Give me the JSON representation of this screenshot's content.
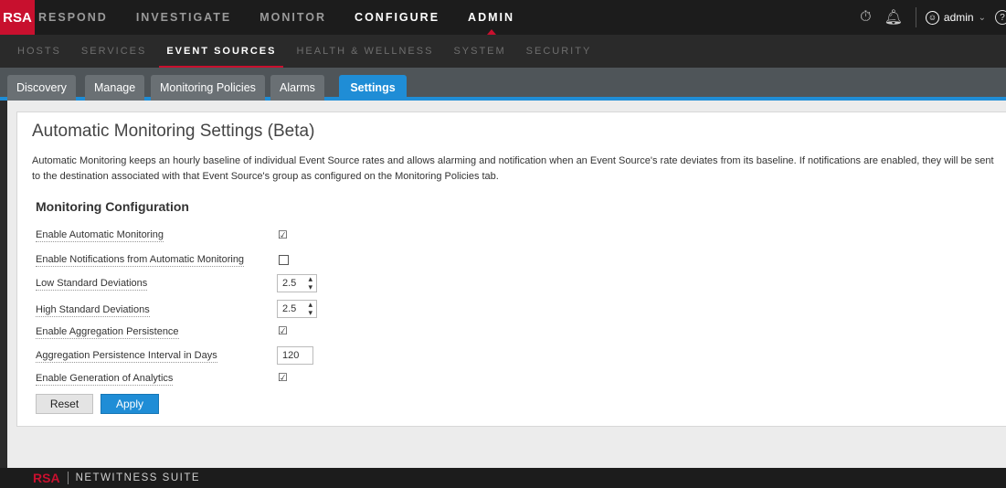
{
  "app": {
    "logo": "RSA",
    "footer_brand": "RSA",
    "footer_product": "NETWITNESS SUITE"
  },
  "topnav": {
    "items": [
      "RESPOND",
      "INVESTIGATE",
      "MONITOR",
      "CONFIGURE",
      "ADMIN"
    ],
    "active": [
      "CONFIGURE",
      "ADMIN"
    ],
    "selected": "ADMIN",
    "user": "admin"
  },
  "subnav": {
    "items": [
      "HOSTS",
      "SERVICES",
      "EVENT SOURCES",
      "HEALTH & WELLNESS",
      "SYSTEM",
      "SECURITY"
    ],
    "active": "EVENT SOURCES"
  },
  "tabs": {
    "items": [
      "Discovery",
      "Manage",
      "Monitoring Policies",
      "Alarms",
      "Settings"
    ],
    "active": "Settings"
  },
  "main": {
    "title": "Automatic Monitoring Settings (Beta)",
    "description": "Automatic Monitoring keeps an hourly baseline of individual Event Source rates and allows alarming and notification when an Event Source's rate deviates from its baseline. If notifications are enabled, they will be sent to the destination associated with that Event Source's group as configured on the Monitoring Policies tab.",
    "section_title": "Monitoring Configuration",
    "fields": {
      "enable_auto": {
        "label": "Enable Automatic Monitoring",
        "checked": true
      },
      "enable_notif": {
        "label": "Enable Notifications from Automatic Monitoring",
        "checked": false
      },
      "low_std": {
        "label": "Low Standard Deviations",
        "value": "2.5"
      },
      "high_std": {
        "label": "High Standard Deviations",
        "value": "2.5"
      },
      "enable_agg": {
        "label": "Enable Aggregation Persistence",
        "checked": true
      },
      "agg_interval": {
        "label": "Aggregation Persistence Interval in Days",
        "value": "120"
      },
      "enable_analytics": {
        "label": "Enable Generation of Analytics",
        "checked": true
      }
    },
    "reset_label": "Reset",
    "apply_label": "Apply"
  },
  "colors": {
    "brand_red": "#c8102e",
    "accent_blue": "#1f8dd6",
    "topbar": "#1c1c1c"
  }
}
